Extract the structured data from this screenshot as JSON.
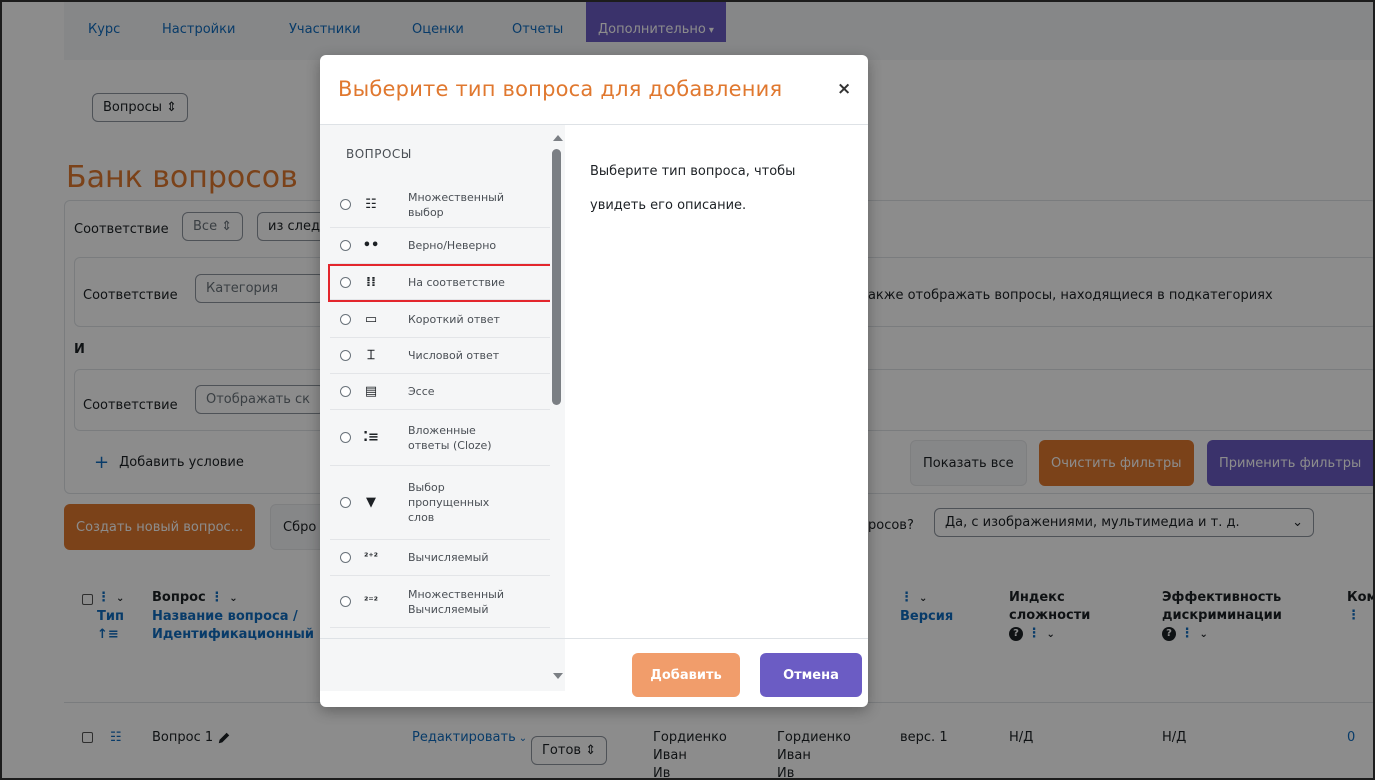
{
  "nav": {
    "items": [
      "Курс",
      "Настройки",
      "Участники",
      "Оценки",
      "Отчеты"
    ],
    "active": "Дополнительно"
  },
  "page": {
    "select_questions": "Вопросы",
    "title": "Банк вопросов",
    "filter": {
      "match_label": "Соответствие",
      "all_value": "Все",
      "of_following": "из следу",
      "row1_label": "Соответствие",
      "row1_field": "Категория",
      "subcat_text": "Также отображать вопросы, находящиеся в подкатегориях",
      "and_label": "И",
      "row2_label": "Соответствие",
      "row2_field": "Отображать ск",
      "add_condition": "Добавить условие",
      "show_all": "Показать все",
      "clear_filters": "Очистить фильтры",
      "apply_filters": "Применить фильтры"
    },
    "create_question": "Создать новый вопрос...",
    "reset_partial": "Сбро",
    "show_media_partial": "росов?",
    "show_media_value": "Да, с изображениями, мультимедиа и т. д."
  },
  "table": {
    "col_type": "Тип",
    "col_question": "Вопрос",
    "col_name": "Название вопроса /",
    "col_ident": "Идентификационный",
    "col_version": "Версия",
    "col_difficulty_1": "Индекс",
    "col_difficulty_2": "сложности",
    "col_discr_1": "Эффективность",
    "col_discr_2": "дискриминации",
    "col_comm": "Ком",
    "row": {
      "name": "Вопрос 1",
      "edit": "Редактировать",
      "status": "Готов",
      "created_1": "Гордиенко",
      "created_2": "Иван",
      "created_3": "Ив",
      "modified_1": "Гордиенко",
      "modified_2": "Иван",
      "modified_3": "Ив",
      "version": "верс. 1",
      "difficulty": "Н/Д",
      "discrimination": "Н/Д",
      "comments": "0"
    }
  },
  "modal": {
    "title": "Выберите тип вопроса для добавления",
    "close": "×",
    "section_heading": "ВОПРОСЫ",
    "description": "Выберите тип вопроса, чтобы увидеть его описание.",
    "items": [
      {
        "label": "Множественный выбор",
        "icon": "list-icon"
      },
      {
        "label": "Верно/Неверно",
        "icon": "two-dots-icon"
      },
      {
        "label": "На соответствие",
        "icon": "matching-grid-icon"
      },
      {
        "label": "Короткий ответ",
        "icon": "short-answer-icon"
      },
      {
        "label": "Числовой ответ",
        "icon": "numerical-icon"
      },
      {
        "label": "Эссе",
        "icon": "essay-icon"
      },
      {
        "label": "Вложенные ответы (Cloze)",
        "icon": "cloze-icon"
      },
      {
        "label": "Выбор пропущенных слов",
        "icon": "dropdown-triangle-icon"
      },
      {
        "label": "Вычисляемый",
        "icon": "calculated-icon"
      },
      {
        "label": "Множественный Вычисляемый",
        "icon": "calculated-multi-icon"
      }
    ],
    "add_button": "Добавить",
    "cancel_button": "Отмена"
  },
  "colors": {
    "accent_orange": "#e0782f",
    "accent_purple": "#6b5cc4",
    "highlight_red": "#e3262d"
  }
}
